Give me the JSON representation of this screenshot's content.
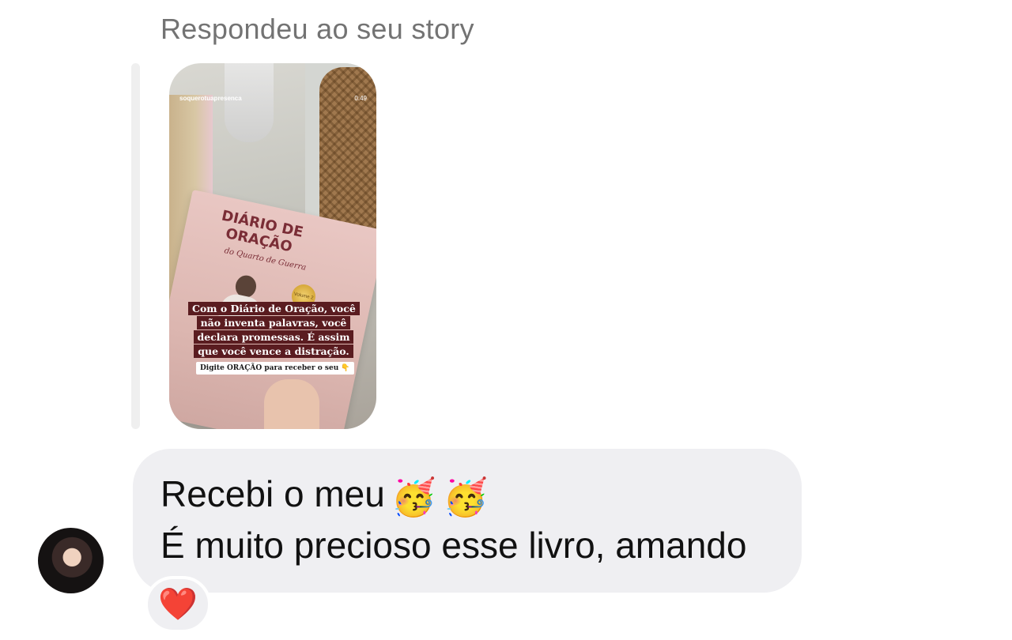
{
  "reply_context": {
    "label": "Respondeu ao seu story"
  },
  "story": {
    "username": "soquerotuapresenca",
    "time": "0:49",
    "book_title": "DIÁRIO DE ORAÇÃO",
    "book_subtitle": "do Quarto de Guerra",
    "badge_text": "Volume 2",
    "caption": "Com o Diário de Oração, você não inventa palavras, você declara promessas. É assim que você vence a distração.",
    "cta": "Digite ORAÇÃO para receber o seu 👇"
  },
  "message": {
    "line1": "Recebi o meu",
    "line1_emojis": [
      "🥳",
      "🥳"
    ],
    "line2": "É muito precioso esse livro, amando"
  },
  "reaction": {
    "emoji": "❤️"
  },
  "colors": {
    "bubble_bg": "#efeff2",
    "muted_text": "#737373",
    "heart": "#e0242f"
  }
}
